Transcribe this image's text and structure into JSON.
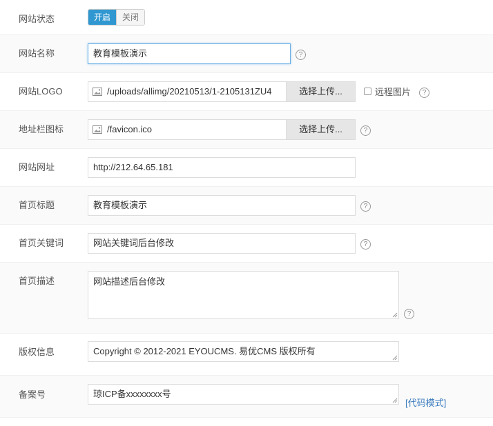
{
  "status": {
    "label": "网站状态",
    "on_label": "开启",
    "off_label": "关闭"
  },
  "site_name": {
    "label": "网站名称",
    "value": "教育模板演示"
  },
  "logo": {
    "label": "网站LOGO",
    "value": "/uploads/allimg/20210513/1-2105131ZU4",
    "upload_label": "选择上传...",
    "remote_label": "远程图片"
  },
  "favicon": {
    "label": "地址栏图标",
    "value": "/favicon.ico",
    "upload_label": "选择上传..."
  },
  "site_url": {
    "label": "网站网址",
    "value": "http://212.64.65.181"
  },
  "home_title": {
    "label": "首页标题",
    "value": "教育模板演示"
  },
  "home_keywords": {
    "label": "首页关键词",
    "value": "网站关键词后台修改"
  },
  "home_description": {
    "label": "首页描述",
    "value": "网站描述后台修改"
  },
  "copyright": {
    "label": "版权信息",
    "value": "Copyright © 2012-2021 EYOUCMS. 易优CMS 版权所有"
  },
  "icp": {
    "label": "备案号",
    "value": "琼ICP备xxxxxxxx号",
    "code_mode_label": "[代码模式]"
  },
  "help_glyph": "?"
}
